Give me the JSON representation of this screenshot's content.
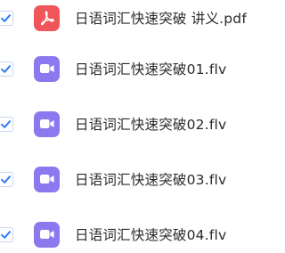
{
  "files": [
    {
      "name": "日语词汇快速突破 讲义.pdf",
      "type": "pdf",
      "checked": true,
      "icon": "pdf-icon"
    },
    {
      "name": "日语词汇快速突破01.flv",
      "type": "video",
      "checked": true,
      "icon": "video-camera-icon"
    },
    {
      "name": "日语词汇快速突破02.flv",
      "type": "video",
      "checked": true,
      "icon": "video-camera-icon"
    },
    {
      "name": "日语词汇快速突破03.flv",
      "type": "video",
      "checked": true,
      "icon": "video-camera-icon"
    },
    {
      "name": "日语词汇快速突破04.flv",
      "type": "video",
      "checked": true,
      "icon": "video-camera-icon"
    }
  ],
  "colors": {
    "check": "#2e7cf6",
    "pdf_icon_bg": "#f0555a",
    "video_icon_bg": "#8c79f0",
    "text": "#2a2a2a"
  }
}
